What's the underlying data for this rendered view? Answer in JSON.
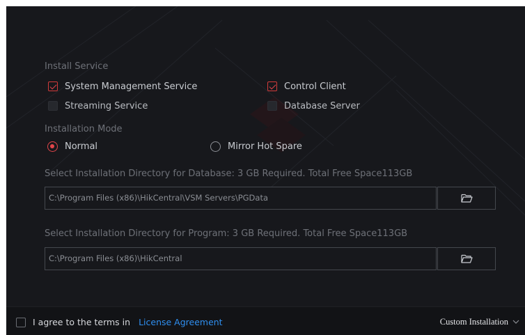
{
  "install_service": {
    "label": "Install Service",
    "options": [
      {
        "label": "System Management Service",
        "checked": true,
        "enabled": true
      },
      {
        "label": "Control Client",
        "checked": true,
        "enabled": true
      },
      {
        "label": "Streaming Service",
        "checked": false,
        "enabled": false
      },
      {
        "label": "Database Server",
        "checked": false,
        "enabled": false
      }
    ]
  },
  "installation_mode": {
    "label": "Installation Mode",
    "options": [
      {
        "label": "Normal",
        "selected": true
      },
      {
        "label": "Mirror Hot Spare",
        "selected": false
      }
    ]
  },
  "database_dir": {
    "label": "Select Installation Directory for Database: 3 GB Required. Total Free Space113GB",
    "path": "C:\\Program Files (x86)\\HikCentral\\VSM Servers\\PGData"
  },
  "program_dir": {
    "label": "Select Installation Directory for Program:  3 GB Required. Total Free Space113GB",
    "path": "C:\\Program Files (x86)\\HikCentral"
  },
  "footer": {
    "agree_text": "I agree to the terms in",
    "license_link": "License Agreement",
    "custom_installation": "Custom Installation",
    "agreed": false
  },
  "icons": {
    "browse": "folder-open-icon",
    "expand": "chevron-down-icon"
  },
  "colors": {
    "accent": "#e2454a",
    "link": "#2f8ff0",
    "background": "#17181c"
  }
}
